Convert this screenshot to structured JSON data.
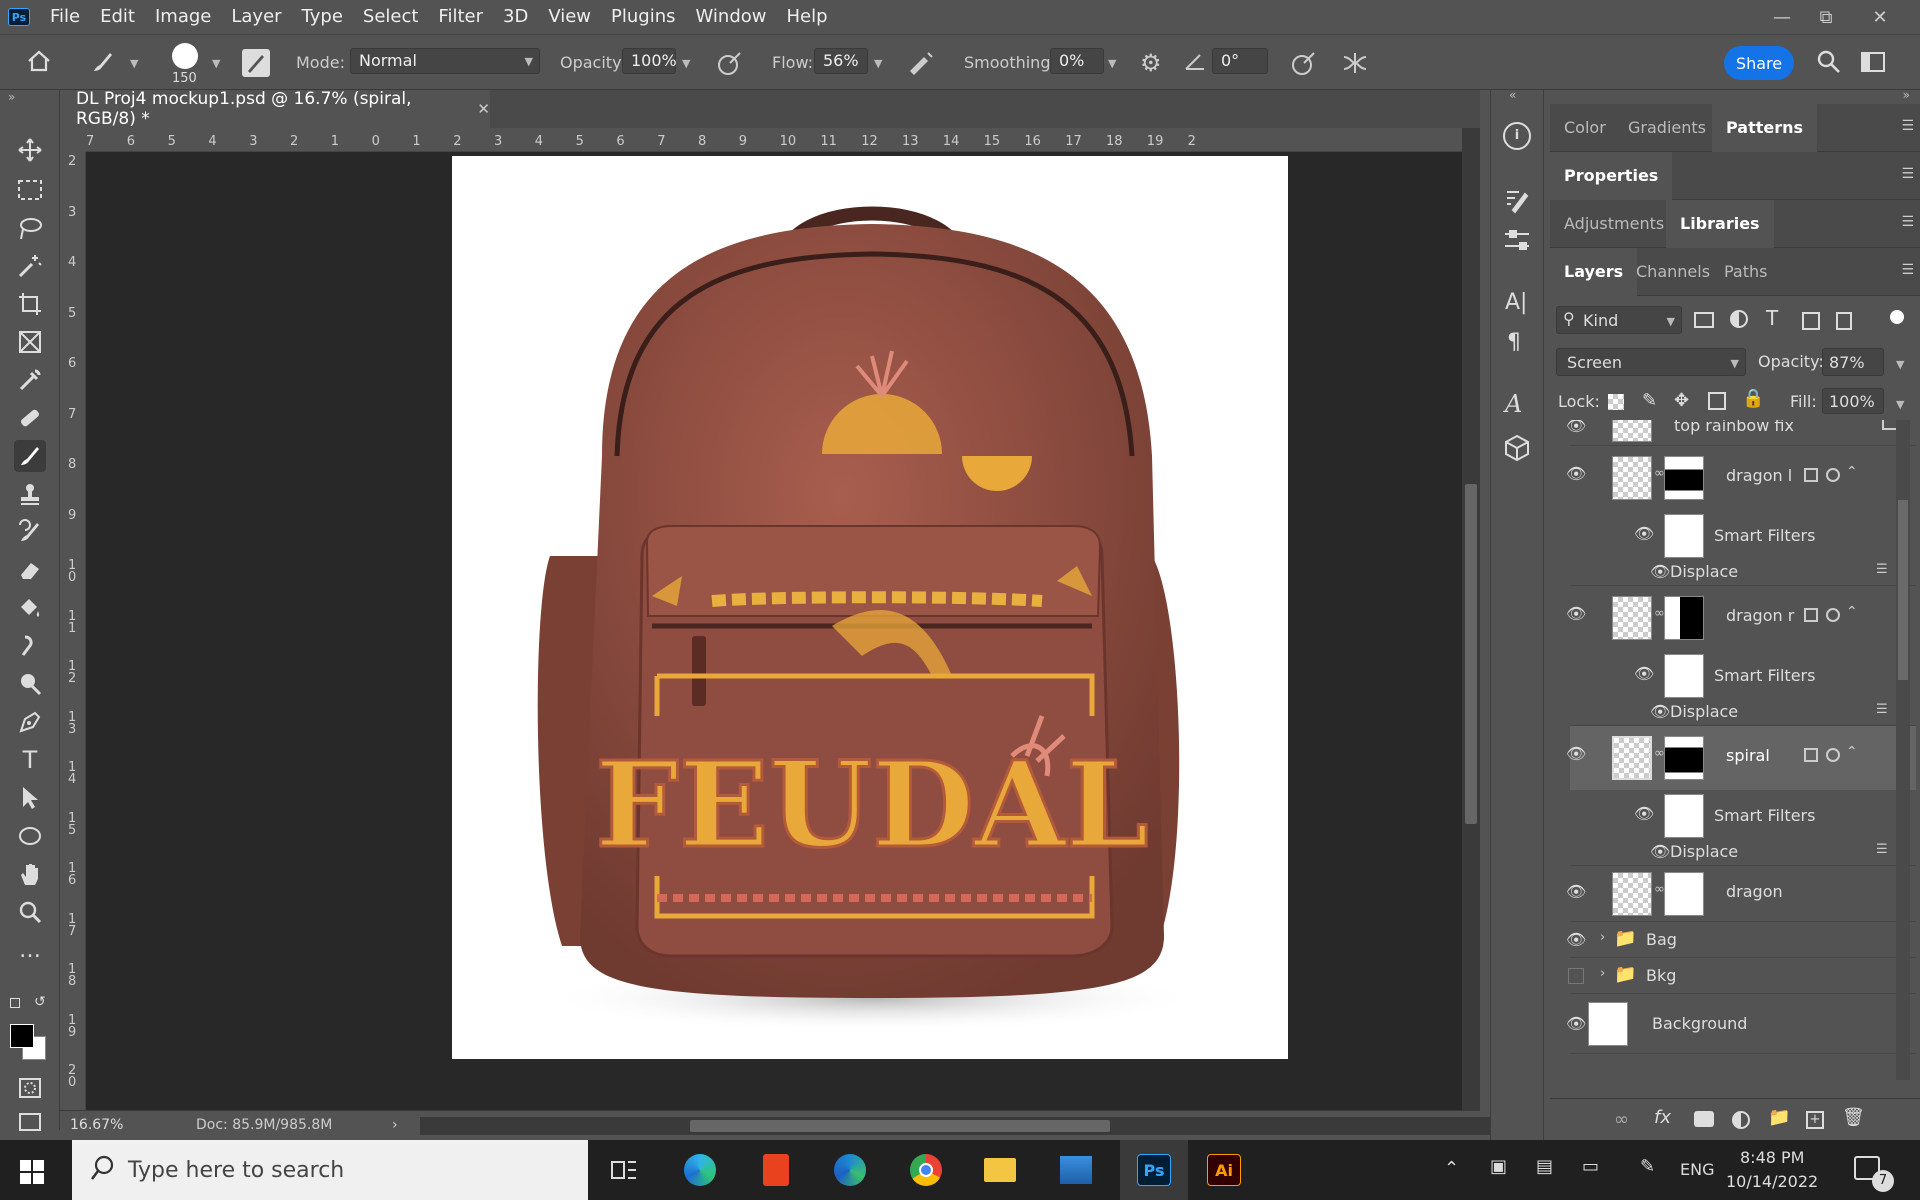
{
  "app": {
    "logo": "Ps",
    "name": "Photoshop"
  },
  "menu": [
    "File",
    "Edit",
    "Image",
    "Layer",
    "Type",
    "Select",
    "Filter",
    "3D",
    "View",
    "Plugins",
    "Window",
    "Help"
  ],
  "options": {
    "brush_size": "150",
    "mode_label": "Mode:",
    "mode_value": "Normal",
    "opacity_label": "Opacity:",
    "opacity_value": "100%",
    "flow_label": "Flow:",
    "flow_value": "56%",
    "smoothing_label": "Smoothing:",
    "smoothing_value": "0%",
    "angle_value": "0°",
    "share_label": "Share"
  },
  "document": {
    "tab_title": "DL Proj4 mockup1.psd @ 16.7% (spiral, RGB/8) *",
    "zoom": "16.67%",
    "doc_info": "Doc: 85.9M/985.8M",
    "ruler_top": [
      "7",
      "6",
      "5",
      "4",
      "3",
      "2",
      "1",
      "0",
      "1",
      "2",
      "3",
      "4",
      "5",
      "6",
      "7",
      "8",
      "9",
      "10",
      "11",
      "12",
      "13",
      "14",
      "15",
      "16",
      "17",
      "18",
      "19",
      "2"
    ],
    "ruler_left": [
      "2",
      "3",
      "4",
      "5",
      "6",
      "7",
      "8",
      "9",
      "1 0",
      "1 1",
      "1 2",
      "1 3",
      "1 4",
      "1 5",
      "1 6",
      "1 7",
      "1 8",
      "1 9",
      "2 0"
    ],
    "artwork_text": "FEUDAL"
  },
  "panels": {
    "row1": [
      "Color",
      "Gradients",
      "Patterns"
    ],
    "row2": [
      "Properties"
    ],
    "row3": [
      "Adjustments",
      "Libraries"
    ],
    "row4": [
      "Layers",
      "Channels",
      "Paths"
    ],
    "filter_kind": "Kind",
    "blend_mode": "Screen",
    "opacity_label": "Opacity:",
    "opacity_value": "87%",
    "lock_label": "Lock:",
    "fill_label": "Fill:",
    "fill_value": "100%"
  },
  "layers": [
    {
      "name": "top rainbow fix",
      "type": "layer"
    },
    {
      "name": "dragon l",
      "type": "smart"
    },
    {
      "name": "Smart Filters",
      "type": "filters"
    },
    {
      "name": "Displace",
      "type": "filter"
    },
    {
      "name": "dragon r",
      "type": "smart"
    },
    {
      "name": "Smart Filters",
      "type": "filters"
    },
    {
      "name": "Displace",
      "type": "filter"
    },
    {
      "name": "spiral",
      "type": "smart",
      "selected": true
    },
    {
      "name": "Smart Filters",
      "type": "filters"
    },
    {
      "name": "Displace",
      "type": "filter"
    },
    {
      "name": "dragon",
      "type": "layer"
    },
    {
      "name": "Bag",
      "type": "group"
    },
    {
      "name": "Bkg",
      "type": "group",
      "hidden": true
    },
    {
      "name": "Background",
      "type": "background"
    }
  ],
  "taskbar": {
    "search_placeholder": "Type here to search",
    "lang": "ENG",
    "time": "8:48 PM",
    "date": "10/14/2022",
    "notifications": "7"
  },
  "colors": {
    "accent": "#1473e6",
    "panel": "#535353",
    "canvas": "#282828",
    "bag": "#8a4a3e",
    "gold": "#e9a83a"
  }
}
